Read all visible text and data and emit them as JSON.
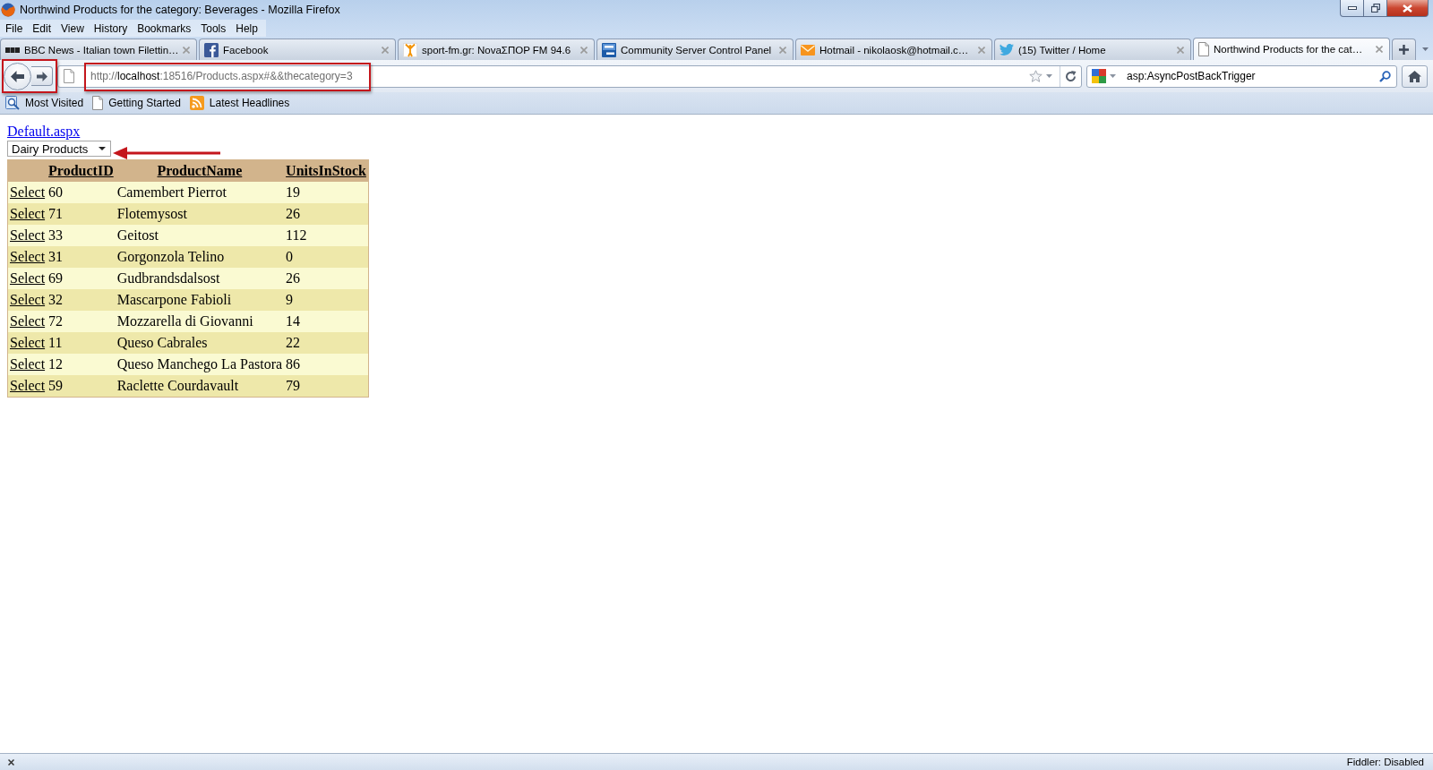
{
  "window": {
    "title": "Northwind Products for the category: Beverages - Mozilla Firefox"
  },
  "menu": [
    {
      "label": "File"
    },
    {
      "label": "Edit"
    },
    {
      "label": "View"
    },
    {
      "label": "History"
    },
    {
      "label": "Bookmarks"
    },
    {
      "label": "Tools"
    },
    {
      "label": "Help"
    }
  ],
  "tabs": [
    {
      "title": "BBC News - Italian town Filettin…",
      "kind": "blocks",
      "selected": false
    },
    {
      "title": "Facebook",
      "kind": "letter_tile",
      "selected": false
    },
    {
      "title": "sport-fm.gr: NovaΣΠΟΡ FM 94.6",
      "kind": "figure",
      "selected": false
    },
    {
      "title": "Community Server Control Panel",
      "kind": "tile",
      "selected": false
    },
    {
      "title": "Hotmail - nikolaosk@hotmail.c…",
      "kind": "envelope",
      "selected": false
    },
    {
      "title": "(15) Twitter / Home",
      "kind": "bird",
      "selected": false
    },
    {
      "title": "Northwind Products for the cat…",
      "kind": "page",
      "selected": true
    }
  ],
  "navigation": {
    "url": "http://**localhost**:18516/Products.aspx#&&thecategory=3"
  },
  "search": {
    "value": "asp:AsyncPostBackTrigger"
  },
  "bookmarks": [
    {
      "label": "Most Visited",
      "kind": "smart"
    },
    {
      "label": "Getting Started",
      "kind": "page"
    },
    {
      "label": "Latest Headlines",
      "kind": "feed"
    }
  ],
  "page": {
    "link": "Default.aspx",
    "category": {
      "value": "Dairy Products"
    },
    "table": {
      "columns": [
        "ProductID",
        "ProductName",
        "UnitsInStock"
      ],
      "rows": [
        {
          "action": "Select",
          "product_id": "60",
          "product_name": "Camembert Pierrot",
          "units_in_stock": "19"
        },
        {
          "action": "Select",
          "product_id": "71",
          "product_name": "Flotemysost",
          "units_in_stock": "26"
        },
        {
          "action": "Select",
          "product_id": "33",
          "product_name": "Geitost",
          "units_in_stock": "112"
        },
        {
          "action": "Select",
          "product_id": "31",
          "product_name": "Gorgonzola Telino",
          "units_in_stock": "0"
        },
        {
          "action": "Select",
          "product_id": "69",
          "product_name": "Gudbrandsdalsost",
          "units_in_stock": "26"
        },
        {
          "action": "Select",
          "product_id": "32",
          "product_name": "Mascarpone Fabioli",
          "units_in_stock": "9"
        },
        {
          "action": "Select",
          "product_id": "72",
          "product_name": "Mozzarella di Giovanni",
          "units_in_stock": "14"
        },
        {
          "action": "Select",
          "product_id": "11",
          "product_name": "Queso Cabrales",
          "units_in_stock": "22"
        },
        {
          "action": "Select",
          "product_id": "12",
          "product_name": "Queso Manchego La Pastora",
          "units_in_stock": "86"
        },
        {
          "action": "Select",
          "product_id": "59",
          "product_name": "Raclette Courdavault",
          "units_in_stock": "79"
        }
      ]
    }
  },
  "status_bar": {
    "text": "Fiddler: Disabled"
  }
}
